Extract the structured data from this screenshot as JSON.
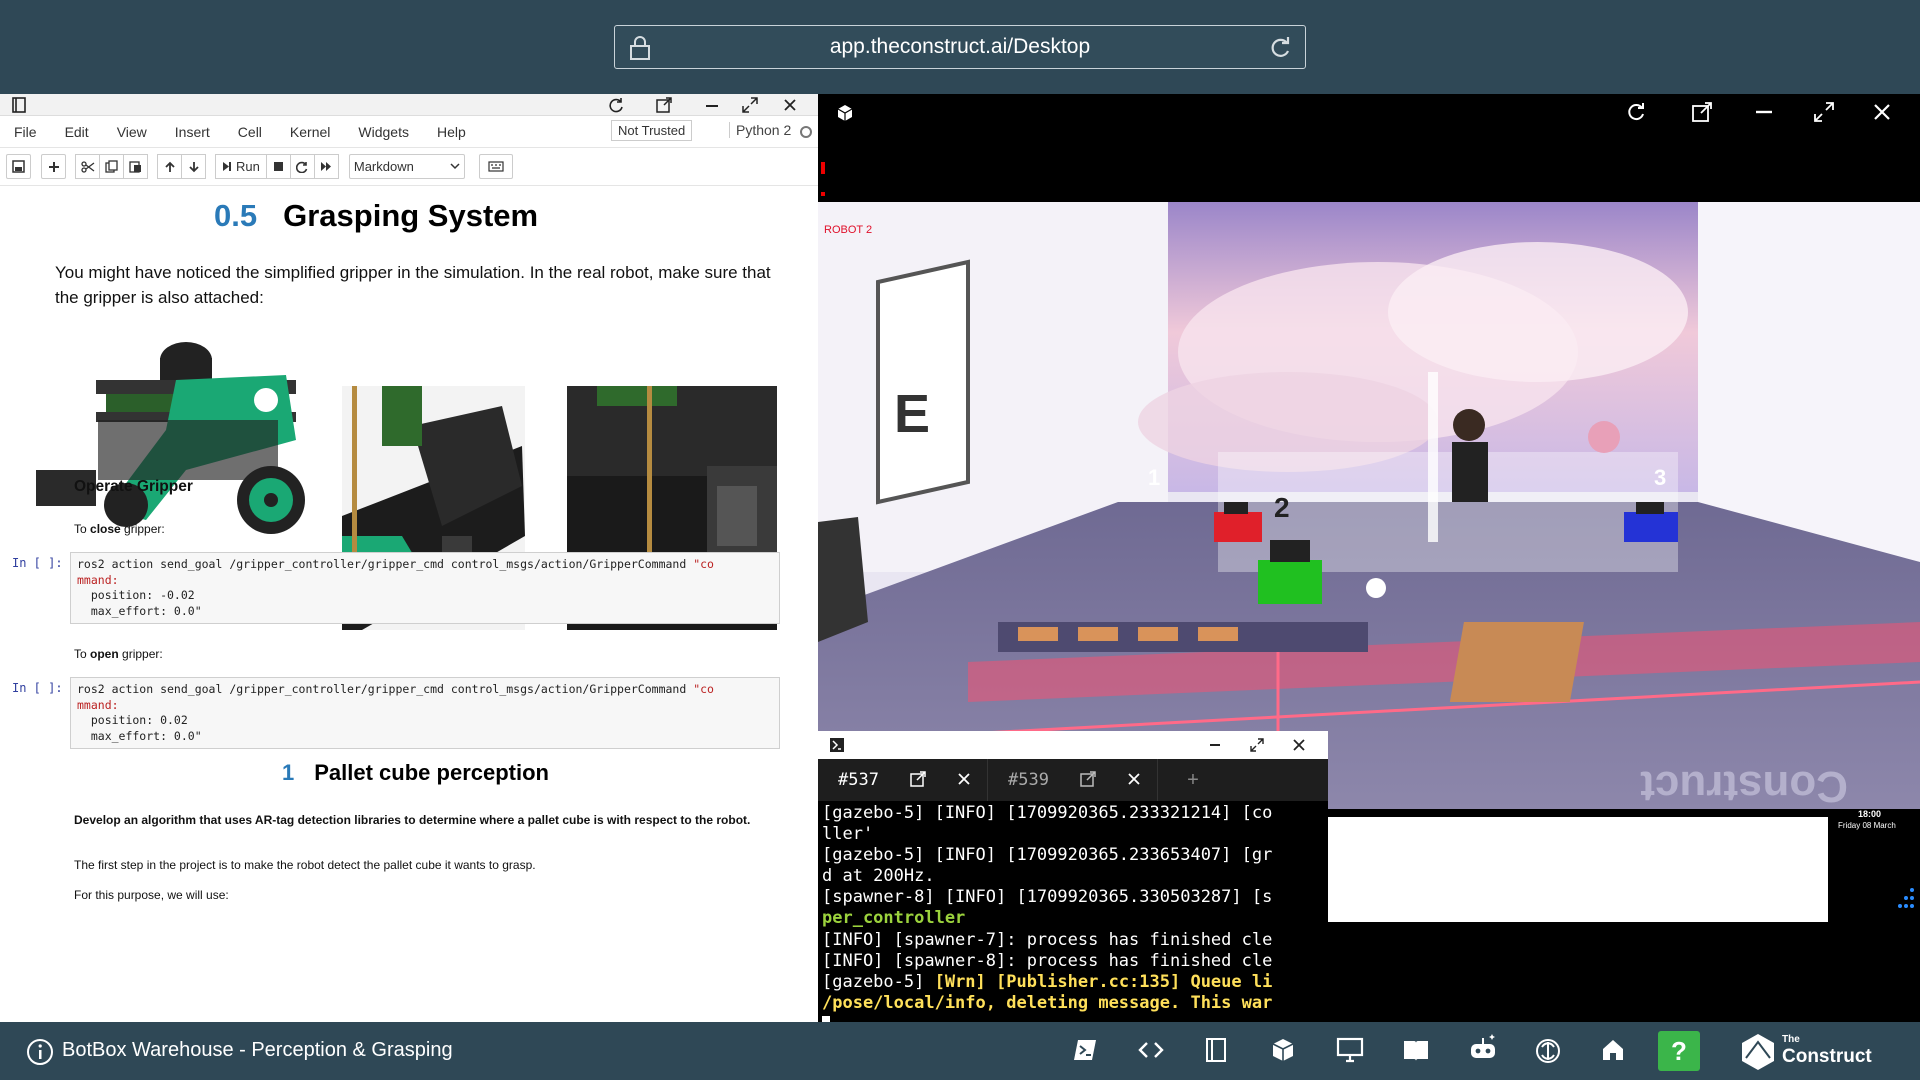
{
  "browser": {
    "url": "app.theconstruct.ai/Desktop"
  },
  "notebook": {
    "menu": [
      "File",
      "Edit",
      "View",
      "Insert",
      "Cell",
      "Kernel",
      "Widgets",
      "Help"
    ],
    "trust": "Not Trusted",
    "kernel": "Python 2",
    "toolbar": {
      "run": "Run",
      "cell_type": "Markdown"
    },
    "heading": {
      "num": "0.5",
      "text": "Grasping System"
    },
    "intro": "You might have noticed the simplified gripper in the simulation. In the real robot, make sure that the gripper is also attached:",
    "operate": "Operate Gripper",
    "close_pre": "To ",
    "close_bold": "close",
    "close_post": " gripper:",
    "open_pre": "To ",
    "open_bold": "open",
    "open_post": " gripper:",
    "prompt": "In [ ]:",
    "code1": {
      "l1": "ros2 action send_goal /gripper_controller/gripper_cmd control_msgs/action/GripperCommand ",
      "s1": "\"co",
      "s2": "mmand:",
      "l3": "  position: -0.02",
      "l4": "  max_effort: 0.0\""
    },
    "code2": {
      "l1": "ros2 action send_goal /gripper_controller/gripper_cmd control_msgs/action/GripperCommand ",
      "s1": "\"co",
      "s2": "mmand:",
      "l3": "  position: 0.02",
      "l4": "  max_effort: 0.0\""
    },
    "heading2": {
      "num": "1",
      "text": "Pallet cube perception"
    },
    "dev": "Develop an algorithm that uses AR-tag detection libraries to determine where a pallet cube is with respect to the robot.",
    "first": "The first step in the project is to make the robot detect the pallet cube it wants to grasp.",
    "purpose": "For this purpose, we will use:"
  },
  "sim": {
    "robot_label": "ROBOT 2",
    "markers": [
      "1",
      "2",
      "3"
    ],
    "wall_letter": "E",
    "floor_text": "Construct",
    "time": "18:00",
    "date": "Friday 08 March"
  },
  "terminal": {
    "tabs": [
      "#537",
      "#539"
    ],
    "add": "+",
    "lines": [
      {
        "t": "[gazebo-5] [INFO] [1709920365.233321214] [co",
        "c": ""
      },
      {
        "t": "ller'",
        "c": ""
      },
      {
        "t": "[gazebo-5] [INFO] [1709920365.233653407] [gr",
        "c": ""
      },
      {
        "t": "d at 200Hz.",
        "c": ""
      },
      {
        "t": "[spawner-8] [INFO] [1709920365.330503287] [s",
        "c": ""
      },
      {
        "t": "per_controller",
        "c": "g"
      },
      {
        "t": "[INFO] [spawner-7]: process has finished cle",
        "c": ""
      },
      {
        "t": "[INFO] [spawner-8]: process has finished cle",
        "c": ""
      },
      {
        "t": "[gazebo-5] ",
        "c": "",
        "y": "[Wrn] [Publisher.cc:135] Queue li"
      },
      {
        "t": "/pose/local/info, deleting message. This war",
        "c": "y"
      }
    ]
  },
  "bottom": {
    "title": "BotBox Warehouse - Perception & Grasping",
    "help": "?",
    "brand_top": "The",
    "brand_main": "Construct"
  },
  "colors": {
    "bg": "#2f4856",
    "help": "#3bb54a",
    "accent": "#2a7ab8",
    "gripper": "#1aa874"
  }
}
